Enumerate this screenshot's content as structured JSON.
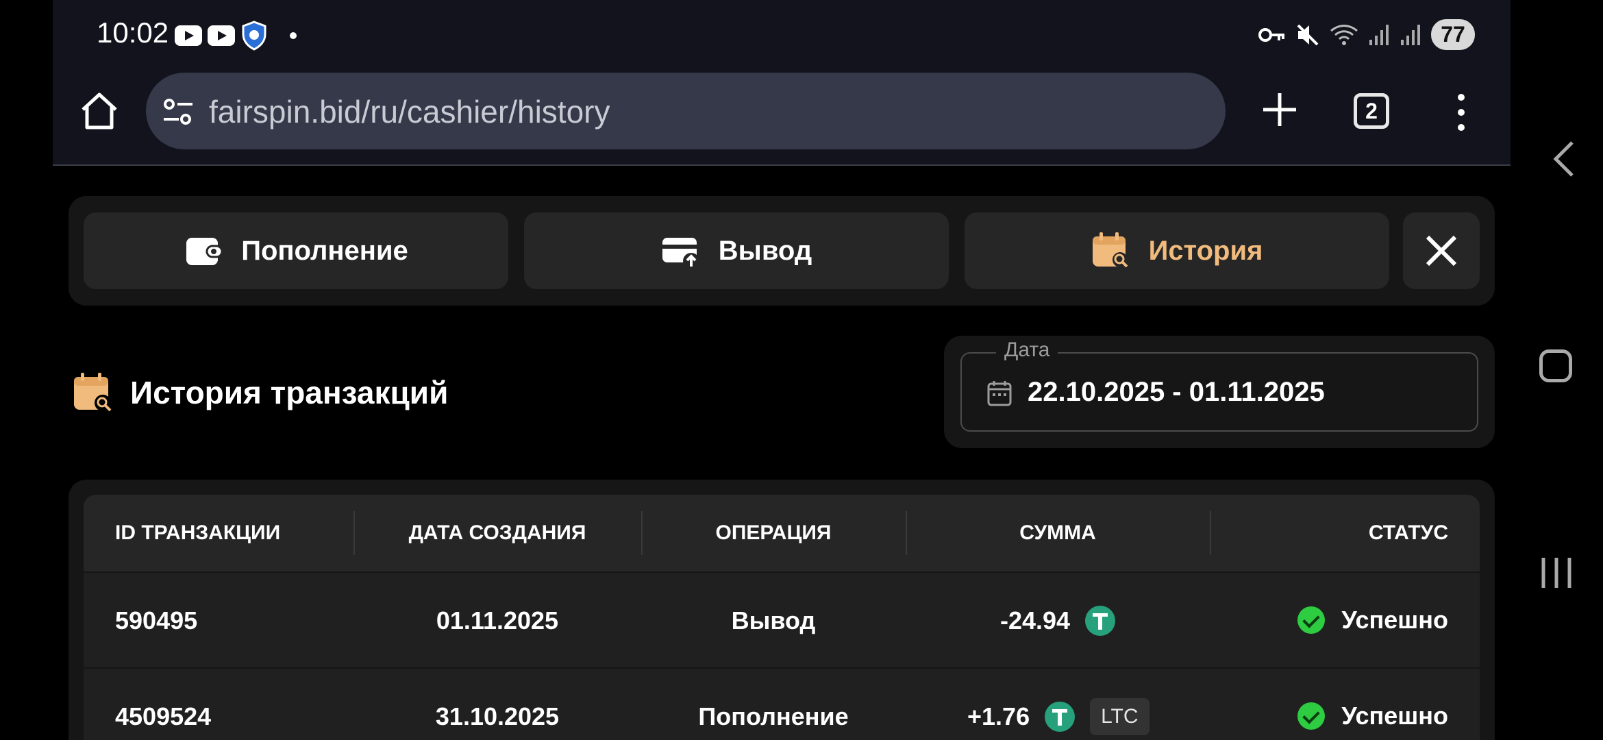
{
  "status_bar": {
    "time": "10:02",
    "battery": "77"
  },
  "browser": {
    "url": "fairspin.bid/ru/cashier/history",
    "tab_count": "2"
  },
  "cashier_tabs": {
    "deposit": "Пополнение",
    "withdraw": "Вывод",
    "history": "История",
    "active": "history",
    "accent_color": "#f2bb7e"
  },
  "section": {
    "title": "История транзакций"
  },
  "date_filter": {
    "label": "Дата",
    "value": "22.10.2025 - 01.11.2025"
  },
  "table": {
    "headers": {
      "id": "ID ТРАНЗАКЦИИ",
      "created": "ДАТА СОЗДАНИЯ",
      "operation": "ОПЕРАЦИЯ",
      "amount": "СУММА",
      "status": "СТАТУС"
    },
    "rows": [
      {
        "id": "590495",
        "date": "01.11.2025",
        "operation": "Вывод",
        "amount": "-24.94",
        "currency_icon": "usdt-icon",
        "network": "",
        "status": "Успешно",
        "status_color": "#2ecc40"
      },
      {
        "id": "4509524",
        "date": "31.10.2025",
        "operation": "Пополнение",
        "amount": "+1.76",
        "currency_icon": "usdt-icon",
        "network": "LTC",
        "status": "Успешно",
        "status_color": "#2ecc40"
      }
    ]
  }
}
